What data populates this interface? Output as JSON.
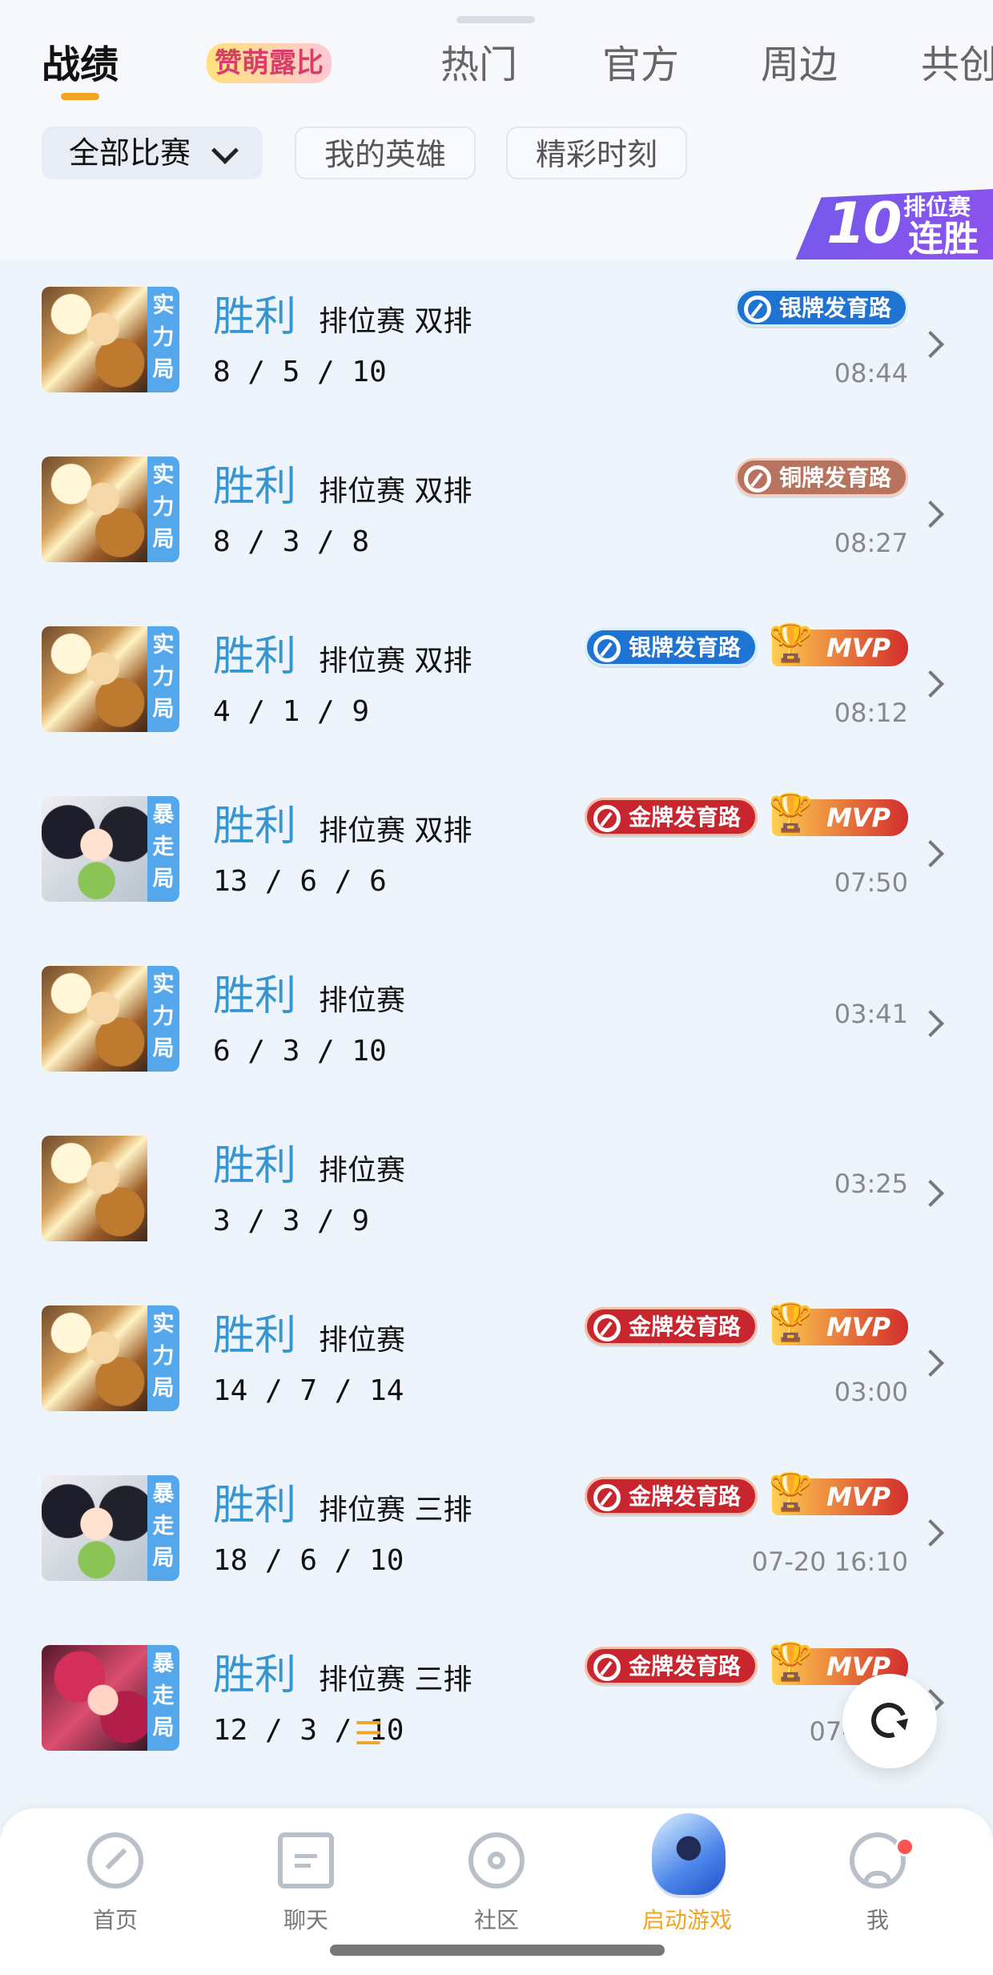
{
  "tabs": [
    {
      "label": "战绩"
    },
    {
      "label": "赞萌露比"
    },
    {
      "label": "热门"
    },
    {
      "label": "官方"
    },
    {
      "label": "周边"
    },
    {
      "label": "共创"
    }
  ],
  "filters": [
    {
      "label": "全部比赛"
    },
    {
      "label": "我的英雄"
    },
    {
      "label": "精彩时刻"
    }
  ],
  "streak_badge": {
    "number": "10",
    "label": "排位赛",
    "text": "连胜"
  },
  "matches": [
    {
      "hero": "hero-gold",
      "mode_label": [
        "实",
        "力",
        "局"
      ],
      "result": "胜利",
      "type": "排位赛 双排",
      "kda": "8 / 5 / 10",
      "badge": "银牌发育路",
      "badge_style": "silver",
      "mvp": "",
      "time": "08:44"
    },
    {
      "hero": "hero-gold",
      "mode_label": [
        "实",
        "力",
        "局"
      ],
      "result": "胜利",
      "type": "排位赛 双排",
      "kda": "8 / 3 / 8",
      "badge": "铜牌发育路",
      "badge_style": "bronze",
      "mvp": "",
      "time": "08:27"
    },
    {
      "hero": "hero-gold",
      "mode_label": [
        "实",
        "力",
        "局"
      ],
      "result": "胜利",
      "type": "排位赛 双排",
      "kda": "4 / 1 / 9",
      "badge": "银牌发育路",
      "badge_style": "silver",
      "mvp": "MVP",
      "time": "08:12"
    },
    {
      "hero": "hero-dark",
      "mode_label": [
        "暴",
        "走",
        "局"
      ],
      "result": "胜利",
      "type": "排位赛 双排",
      "kda": "13 / 6 / 6",
      "badge": "金牌发育路",
      "badge_style": "gold",
      "mvp": "MVP",
      "time": "07:50"
    },
    {
      "hero": "hero-gold",
      "mode_label": [
        "实",
        "力",
        "局"
      ],
      "result": "胜利",
      "type": "排位赛",
      "kda": "6 / 3 / 10",
      "badge": "",
      "badge_style": "",
      "mvp": "",
      "time": "03:41"
    },
    {
      "hero": "hero-gold",
      "mode_label": [],
      "result": "胜利",
      "type": "排位赛",
      "kda": "3 / 3 / 9",
      "badge": "",
      "badge_style": "",
      "mvp": "",
      "time": "03:25"
    },
    {
      "hero": "hero-gold",
      "mode_label": [
        "实",
        "力",
        "局"
      ],
      "result": "胜利",
      "type": "排位赛",
      "kda": "14 / 7 / 14",
      "badge": "金牌发育路",
      "badge_style": "gold",
      "mvp": "MVP",
      "time": "03:00"
    },
    {
      "hero": "hero-dark",
      "mode_label": [
        "暴",
        "走",
        "局"
      ],
      "result": "胜利",
      "type": "排位赛 三排",
      "kda": "18 / 6 / 10",
      "badge": "金牌发育路",
      "badge_style": "gold",
      "mvp": "MVP",
      "time": "07-20 16:10"
    },
    {
      "hero": "hero-pink",
      "mode_label": [
        "暴",
        "走",
        "局"
      ],
      "result": "胜利",
      "type": "排位赛 三排",
      "kda": "12 / 3 / 10",
      "badge": "金牌发育路",
      "badge_style": "gold",
      "mvp": "MVP",
      "time": "07-20 1",
      "extra_icon": "menu-lines-icon"
    }
  ],
  "bottom_nav": [
    {
      "label": "首页",
      "icon": "compass-icon"
    },
    {
      "label": "聊天",
      "icon": "chat-icon"
    },
    {
      "label": "社区",
      "icon": "community-icon"
    },
    {
      "label": "启动游戏",
      "icon": "game-icon"
    },
    {
      "label": "我",
      "icon": "profile-icon"
    }
  ],
  "colors": {
    "accent": "#f3a323",
    "win": "#3795d2",
    "background": "#edf4fb"
  }
}
